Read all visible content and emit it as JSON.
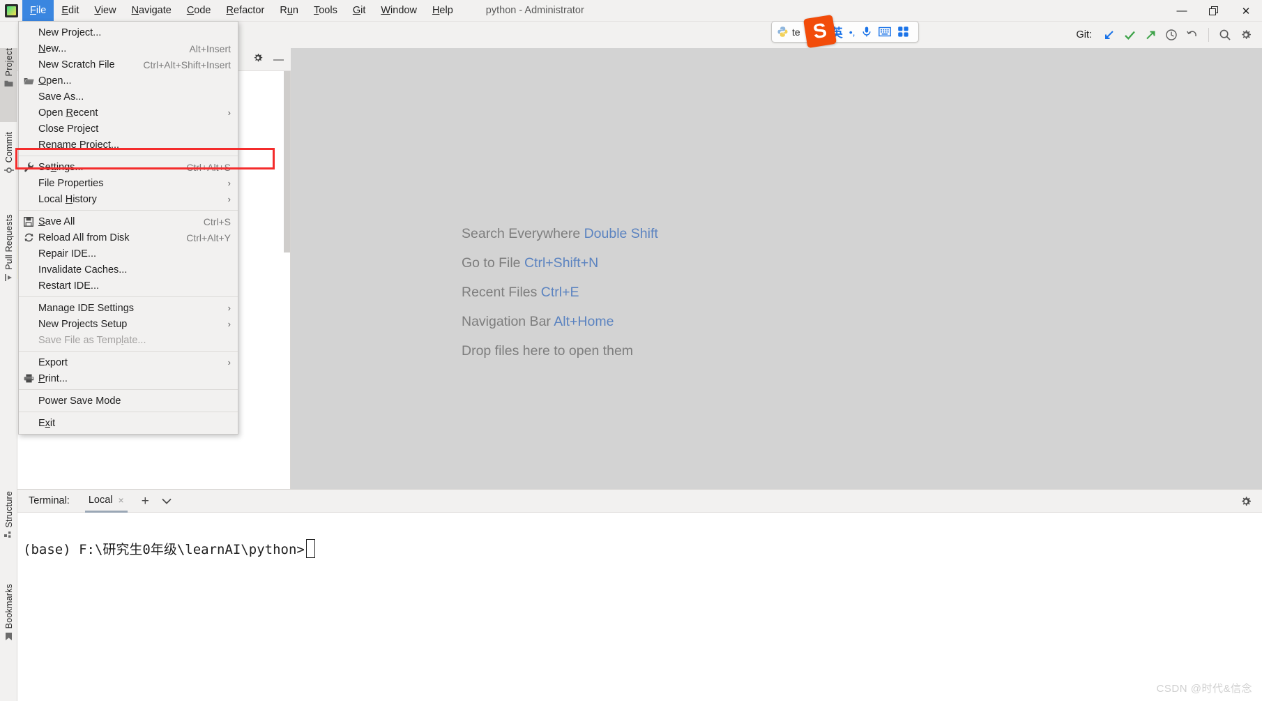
{
  "window": {
    "title": "python - Administrator",
    "controls": [
      {
        "name": "minimize",
        "glyph": "—"
      },
      {
        "name": "restore",
        "glyph": "❐"
      },
      {
        "name": "close",
        "glyph": "✕"
      }
    ]
  },
  "menubar": {
    "items": [
      {
        "label": "File",
        "mnemonic": "F",
        "active": true
      },
      {
        "label": "Edit",
        "mnemonic": "E",
        "active": false
      },
      {
        "label": "View",
        "mnemonic": "V",
        "active": false
      },
      {
        "label": "Navigate",
        "mnemonic": "N",
        "active": false
      },
      {
        "label": "Code",
        "mnemonic": "C",
        "active": false
      },
      {
        "label": "Refactor",
        "mnemonic": "R",
        "active": false
      },
      {
        "label": "Run",
        "mnemonic": "u",
        "active": false
      },
      {
        "label": "Tools",
        "mnemonic": "T",
        "active": false
      },
      {
        "label": "Git",
        "mnemonic": "G",
        "active": false
      },
      {
        "label": "Window",
        "mnemonic": "W",
        "active": false
      },
      {
        "label": "Help",
        "mnemonic": "H",
        "active": false
      }
    ]
  },
  "file_menu": {
    "items": [
      {
        "label": "New Project...",
        "shortcut": "",
        "icon": "",
        "arrow": false,
        "disabled": false,
        "sep_after": false
      },
      {
        "label": "New...",
        "shortcut": "Alt+Insert",
        "icon": "",
        "arrow": false,
        "disabled": false,
        "sep_after": false,
        "mnemonic": "N"
      },
      {
        "label": "New Scratch File",
        "shortcut": "Ctrl+Alt+Shift+Insert",
        "icon": "",
        "arrow": false,
        "disabled": false,
        "sep_after": false
      },
      {
        "label": "Open...",
        "shortcut": "",
        "icon": "folder-icon",
        "arrow": false,
        "disabled": false,
        "sep_after": false,
        "mnemonic": "O"
      },
      {
        "label": "Save As...",
        "shortcut": "",
        "icon": "",
        "arrow": false,
        "disabled": false,
        "sep_after": false
      },
      {
        "label": "Open Recent",
        "shortcut": "",
        "icon": "",
        "arrow": true,
        "disabled": false,
        "sep_after": false,
        "mnemonic": "R"
      },
      {
        "label": "Close Project",
        "shortcut": "",
        "icon": "",
        "arrow": false,
        "disabled": false,
        "sep_after": false
      },
      {
        "label": "Rename Project...",
        "shortcut": "",
        "icon": "",
        "arrow": false,
        "disabled": false,
        "sep_after": true
      },
      {
        "label": "Settings...",
        "shortcut": "Ctrl+Alt+S",
        "icon": "wrench-icon",
        "arrow": false,
        "disabled": false,
        "sep_after": false,
        "mnemonic": "tt",
        "highlighted": true
      },
      {
        "label": "File Properties",
        "shortcut": "",
        "icon": "",
        "arrow": true,
        "disabled": false,
        "sep_after": false
      },
      {
        "label": "Local History",
        "shortcut": "",
        "icon": "",
        "arrow": true,
        "disabled": false,
        "sep_after": true,
        "mnemonic": "H"
      },
      {
        "label": "Save All",
        "shortcut": "Ctrl+S",
        "icon": "save-icon",
        "arrow": false,
        "disabled": false,
        "sep_after": false,
        "mnemonic": "S"
      },
      {
        "label": "Reload All from Disk",
        "shortcut": "Ctrl+Alt+Y",
        "icon": "reload-icon",
        "arrow": false,
        "disabled": false,
        "sep_after": false
      },
      {
        "label": "Repair IDE...",
        "shortcut": "",
        "icon": "",
        "arrow": false,
        "disabled": false,
        "sep_after": false
      },
      {
        "label": "Invalidate Caches...",
        "shortcut": "",
        "icon": "",
        "arrow": false,
        "disabled": false,
        "sep_after": false
      },
      {
        "label": "Restart IDE...",
        "shortcut": "",
        "icon": "",
        "arrow": false,
        "disabled": false,
        "sep_after": true
      },
      {
        "label": "Manage IDE Settings",
        "shortcut": "",
        "icon": "",
        "arrow": true,
        "disabled": false,
        "sep_after": false
      },
      {
        "label": "New Projects Setup",
        "shortcut": "",
        "icon": "",
        "arrow": true,
        "disabled": false,
        "sep_after": false
      },
      {
        "label": "Save File as Template...",
        "shortcut": "",
        "icon": "",
        "arrow": false,
        "disabled": true,
        "sep_after": true
      },
      {
        "label": "Export",
        "shortcut": "",
        "icon": "",
        "arrow": true,
        "disabled": false,
        "sep_after": false
      },
      {
        "label": "Print...",
        "shortcut": "",
        "icon": "printer-icon",
        "arrow": false,
        "disabled": false,
        "sep_after": true,
        "mnemonic": "P"
      },
      {
        "label": "Power Save Mode",
        "shortcut": "",
        "icon": "",
        "arrow": false,
        "disabled": false,
        "sep_after": true
      },
      {
        "label": "Exit",
        "shortcut": "",
        "icon": "",
        "arrow": false,
        "disabled": false,
        "sep_after": false,
        "mnemonic": "x"
      }
    ],
    "highlight_color": "#f42c2c"
  },
  "toolbar": {
    "git_label": "Git:",
    "icons": [
      {
        "name": "user-avatar-icon"
      },
      {
        "name": "git-update-icon",
        "color": "#3a86e0"
      },
      {
        "name": "git-commit-check-icon",
        "color": "#3fa34a"
      },
      {
        "name": "git-push-icon",
        "color": "#3fa34a"
      },
      {
        "name": "history-icon",
        "color": "#5c5c5c"
      },
      {
        "name": "rollback-icon",
        "color": "#5c5c5c"
      },
      {
        "name": "search-icon",
        "color": "#5c5c5c"
      },
      {
        "name": "settings-gear-icon",
        "color": "#5c5c5c"
      }
    ]
  },
  "ime": {
    "brand_letter": "S",
    "brand_color": "#f24c0a",
    "text": "te",
    "mode_label": "英",
    "punctuation_label": "•,",
    "icons": [
      "python-icon",
      "voice-input-icon",
      "soft-keyboard-icon",
      "toolbox-icon"
    ]
  },
  "left_tool_strip": {
    "top_tabs": [
      {
        "label": "Project",
        "icon": "folder-icon",
        "selected": true
      },
      {
        "label": "Commit",
        "icon": "commit-icon",
        "selected": false
      },
      {
        "label": "Pull Requests",
        "icon": "pull-request-icon",
        "selected": false
      }
    ],
    "bottom_tabs": [
      {
        "label": "Structure",
        "icon": "structure-icon",
        "selected": false
      },
      {
        "label": "Bookmarks",
        "icon": "bookmark-icon",
        "selected": false
      }
    ]
  },
  "editor": {
    "hints": [
      {
        "text": "Search Everywhere",
        "key": "Double Shift"
      },
      {
        "text": "Go to File",
        "key": "Ctrl+Shift+N"
      },
      {
        "text": "Recent Files",
        "key": "Ctrl+E"
      },
      {
        "text": "Navigation Bar",
        "key": "Alt+Home"
      },
      {
        "text": "Drop files here to open them",
        "key": ""
      }
    ],
    "key_color": "#5b83c0"
  },
  "terminal": {
    "label": "Terminal:",
    "tab": "Local",
    "close_glyph": "×",
    "add_glyph": "+",
    "chevron_glyph": "⌄",
    "prompt": "(base) F:\\研究生0年级\\learnAI\\python>"
  },
  "watermark": {
    "text": "CSDN @时代&信念"
  }
}
